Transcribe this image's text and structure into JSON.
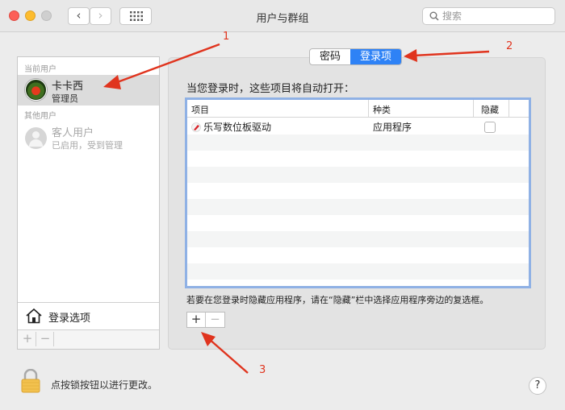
{
  "window": {
    "title": "用户与群组",
    "nav_back": "‹",
    "nav_forward": "›"
  },
  "search": {
    "placeholder": "搜索"
  },
  "sidebar": {
    "current_users_label": "当前用户",
    "current_user": {
      "name": "卡卡西",
      "role": "管理员"
    },
    "other_users_label": "其他用户",
    "guest_user": {
      "name": "客人用户",
      "status": "已启用，受到管理"
    },
    "login_options": "登录选项",
    "add_button": "+",
    "remove_button": "−"
  },
  "tabs": [
    {
      "label": "密码",
      "selected": false
    },
    {
      "label": "登录项",
      "selected": true
    }
  ],
  "login_items": {
    "heading": "当您登录时，这些项目将自动打开：",
    "columns": [
      "项目",
      "种类",
      "隐藏"
    ],
    "rows": [
      {
        "name": "乐写数位板驱动",
        "kind": "应用程序",
        "hidden": false
      }
    ],
    "hint": "若要在您登录时隐藏应用程序，请在“隐藏”栏中选择应用程序旁边的复选框。",
    "add_button": "+",
    "remove_button": "−"
  },
  "footer": {
    "lock_text": "点按锁按钮以进行更改。",
    "help": "?"
  },
  "annotations": [
    "1",
    "2",
    "3"
  ],
  "colors": {
    "accent": "#2e82f6",
    "annotation": "#e0341e",
    "table_focus": "#8fb1e5"
  }
}
